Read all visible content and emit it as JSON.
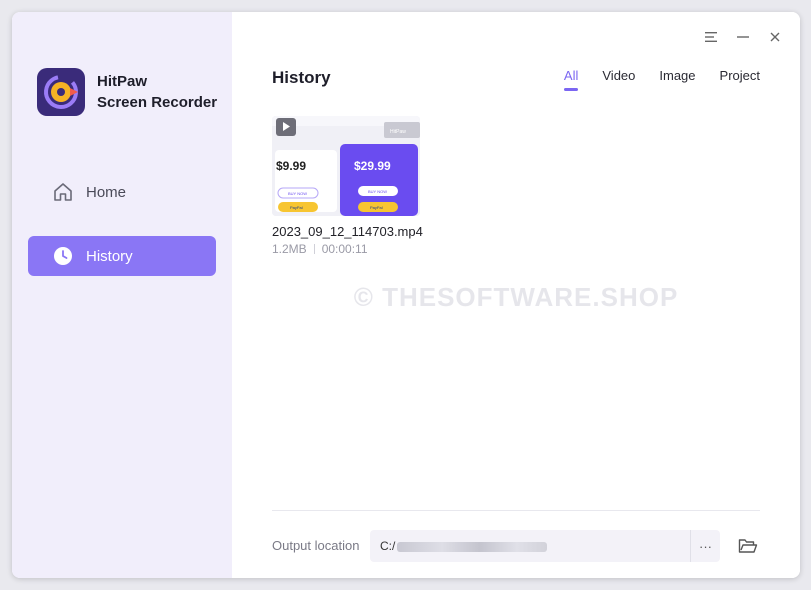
{
  "app": {
    "name_line1": "HitPaw",
    "name_line2": "Screen Recorder",
    "logo_icon": "hitpaw-logo-icon"
  },
  "sidebar": {
    "items": [
      {
        "label": "Home",
        "icon": "home-icon",
        "active": false
      },
      {
        "label": "History",
        "icon": "clock-icon",
        "active": true
      }
    ]
  },
  "window_controls": {
    "menu_icon": "menu-icon",
    "minimize_icon": "minimize-icon",
    "close_icon": "close-icon"
  },
  "main": {
    "title": "History",
    "tabs": [
      {
        "label": "All",
        "active": true
      },
      {
        "label": "Video",
        "active": false
      },
      {
        "label": "Image",
        "active": false
      },
      {
        "label": "Project",
        "active": false
      }
    ],
    "files": [
      {
        "name": "2023_09_12_114703.mp4",
        "size": "1.2MB",
        "duration": "00:00:11",
        "thumbnail": {
          "left_price": "$9.99",
          "right_price": "$29.99",
          "badge": "HitPaw",
          "buy_label": "BUY NOW",
          "pay_label": "PayPal"
        }
      }
    ]
  },
  "watermark": "© THESOFTWARE.SHOP",
  "footer": {
    "output_label": "Output location",
    "output_path_prefix": "C:/",
    "browse_label": "···",
    "folder_icon": "folder-open-icon"
  },
  "colors": {
    "accent": "#7b66f2",
    "sidebar_bg": "#f1eefb",
    "active_nav": "#8a76f5"
  }
}
